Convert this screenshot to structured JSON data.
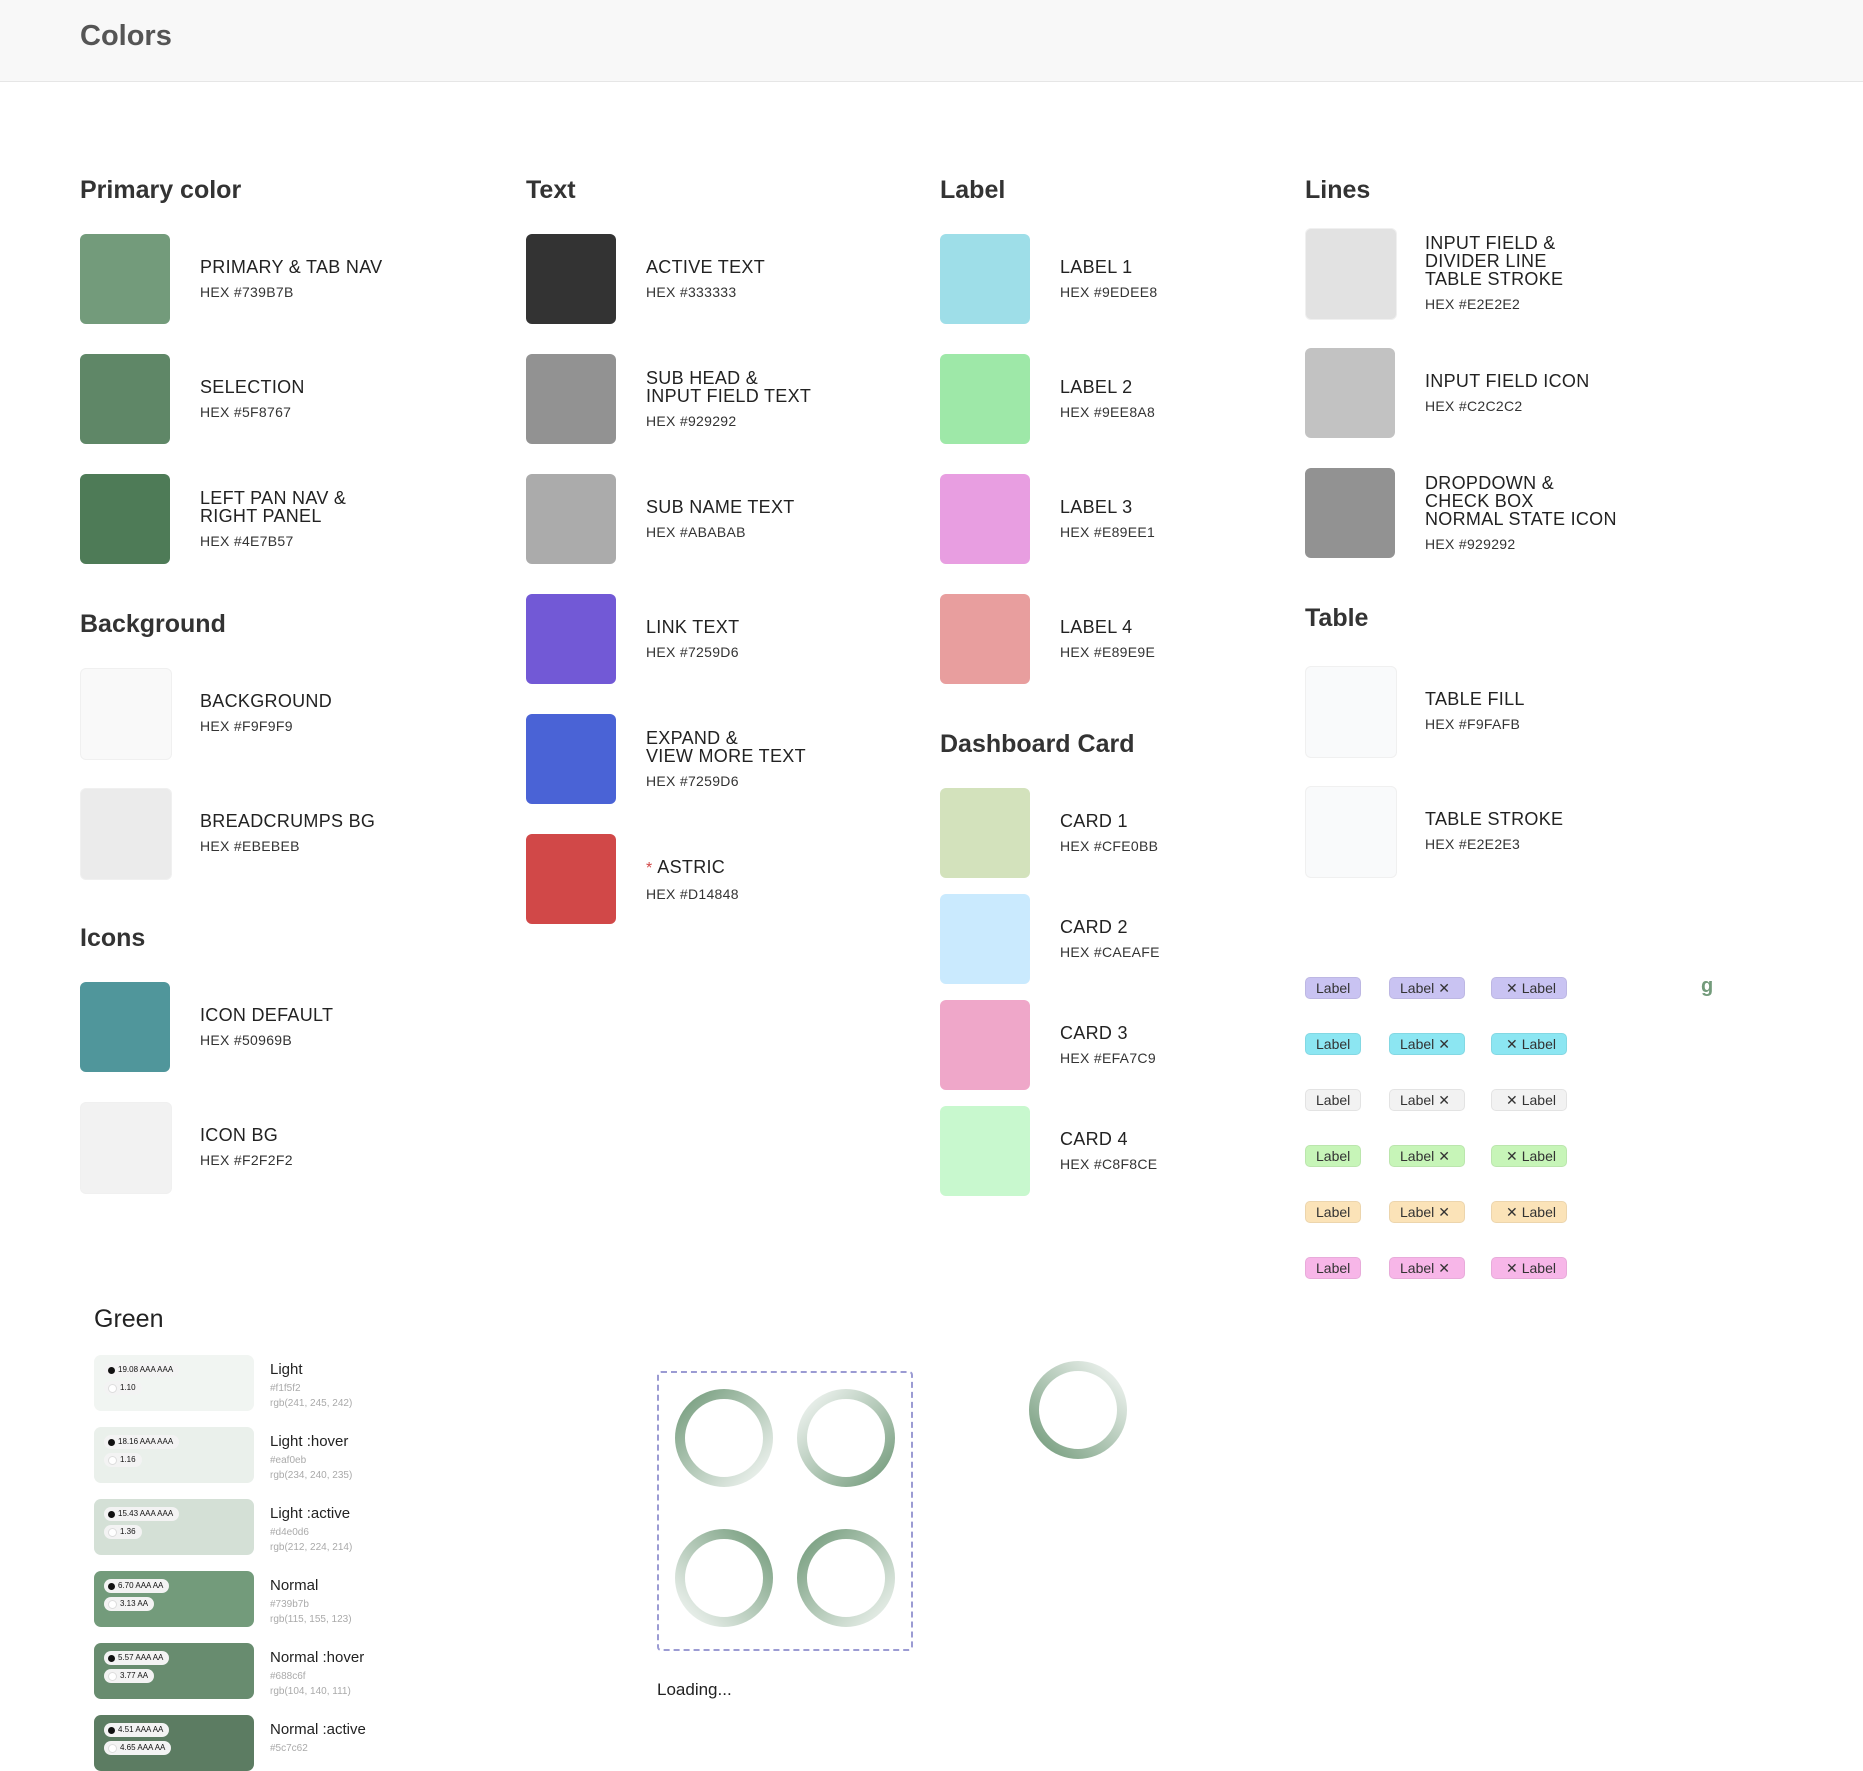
{
  "page": {
    "title": "Colors"
  },
  "sections": {
    "primary": {
      "title": "Primary color",
      "items": [
        {
          "name": "PRIMARY & TAB NAV",
          "hex": "HEX #739B7B",
          "color": "#739B7B"
        },
        {
          "name": "SELECTION",
          "hex": "HEX #5F8767",
          "color": "#5F8767"
        },
        {
          "name": "LEFT PAN NAV &\nRIGHT PANEL",
          "hex": "HEX #4E7B57",
          "color": "#4E7B57"
        }
      ]
    },
    "background": {
      "title": "Background",
      "items": [
        {
          "name": "BACKGROUND",
          "hex": "HEX #F9F9F9",
          "color": "#F9F9F9"
        },
        {
          "name": "BREADCRUMPS BG",
          "hex": "HEX #EBEBEB",
          "color": "#EBEBEB"
        }
      ]
    },
    "icons": {
      "title": "Icons",
      "items": [
        {
          "name": "ICON DEFAULT",
          "hex": "HEX #50969B",
          "color": "#50969B"
        },
        {
          "name": "ICON BG",
          "hex": "HEX #F2F2F2",
          "color": "#F2F2F2"
        }
      ]
    },
    "text": {
      "title": "Text",
      "items": [
        {
          "name": "ACTIVE TEXT",
          "hex": "HEX #333333",
          "color": "#333333"
        },
        {
          "name": "SUB HEAD &\nINPUT FIELD TEXT",
          "hex": "HEX #929292",
          "color": "#929292"
        },
        {
          "name": "SUB NAME TEXT",
          "hex": "HEX #ABABAB",
          "color": "#ABABAB"
        },
        {
          "name": "LINK TEXT",
          "hex": "HEX #7259D6",
          "color": "#7259D6"
        },
        {
          "name": "EXPAND &\nVIEW MORE TEXT",
          "hex": "HEX #7259D6",
          "color": "#4A63D6"
        },
        {
          "required_mark": "*",
          "name": "ASTRIC",
          "hex": "HEX #D14848",
          "color": "#D14848"
        }
      ]
    },
    "label": {
      "title": "Label",
      "items": [
        {
          "name": "LABEL 1",
          "hex": "HEX #9EDEE8",
          "color": "#9EDEE8"
        },
        {
          "name": "LABEL 2",
          "hex": "HEX #9EE8A8",
          "color": "#9EE8A8"
        },
        {
          "name": "LABEL 3",
          "hex": "HEX #E89EE1",
          "color": "#E89EE1"
        },
        {
          "name": "LABEL 4",
          "hex": "HEX #E89E9E",
          "color": "#E89E9E"
        }
      ]
    },
    "dashboard": {
      "title": "Dashboard Card",
      "items": [
        {
          "name": "CARD 1",
          "hex": "HEX #CFE0BB",
          "color": "#D3E2BC"
        },
        {
          "name": "CARD 2",
          "hex": "HEX #CAEAFE",
          "color": "#CAEAFE"
        },
        {
          "name": "CARD 3",
          "hex": "HEX #EFA7C9",
          "color": "#EFA7C9"
        },
        {
          "name": "CARD 4",
          "hex": "HEX #C8F8CE",
          "color": "#C8F8CE"
        }
      ]
    },
    "lines": {
      "title": "Lines",
      "items": [
        {
          "name": "INPUT FIELD &\nDIVIDER LINE\nTABLE STROKE",
          "hex": "HEX #E2E2E2",
          "color": "#E2E2E2"
        },
        {
          "name": "INPUT FIELD ICON",
          "hex": "HEX #C2C2C2",
          "color": "#C2C2C2"
        },
        {
          "name": "DROPDOWN &\nCHECK BOX\nNORMAL STATE ICON",
          "hex": "HEX #929292",
          "color": "#929292"
        }
      ]
    },
    "table": {
      "title": "Table",
      "items": [
        {
          "name": "TABLE FILL",
          "hex": "HEX #F9FAFB",
          "color": "#F9FAFB"
        },
        {
          "name": "TABLE STROKE",
          "hex": "HEX #E2E2E3",
          "color": "#F9FAFB"
        }
      ]
    }
  },
  "chips": {
    "label": "Label",
    "close_glyph": "✕",
    "rows": [
      "#c9c3f2",
      "#8ce6f2",
      "#f2f2f2",
      "#c7f5b8",
      "#fbe3b8",
      "#f7b6e8"
    ]
  },
  "stray_glyph": "g",
  "green": {
    "title": "Green",
    "items": [
      {
        "name": "Light",
        "hex": "#f1f5f2",
        "rgb": "rgb(241, 245, 242)",
        "color": "#f1f5f2",
        "badge1": "19.08 AAA AAA",
        "badge2": "1.10"
      },
      {
        "name": "Light :hover",
        "hex": "#eaf0eb",
        "rgb": "rgb(234, 240, 235)",
        "color": "#eaf0eb",
        "badge1": "18.16 AAA AAA",
        "badge2": "1.16"
      },
      {
        "name": "Light :active",
        "hex": "#d4e0d6",
        "rgb": "rgb(212, 224, 214)",
        "color": "#d4e0d6",
        "badge1": "15.43 AAA AAA",
        "badge2": "1.36"
      },
      {
        "name": "Normal",
        "hex": "#739b7b",
        "rgb": "rgb(115, 155, 123)",
        "color": "#739b7b",
        "badge1": "6.70 AAA AA",
        "badge2": "3.13 AA"
      },
      {
        "name": "Normal :hover",
        "hex": "#688c6f",
        "rgb": "rgb(104, 140, 111)",
        "color": "#688c6f",
        "badge1": "5.57 AAA AA",
        "badge2": "3.77 AA"
      },
      {
        "name": "Normal :active",
        "hex": "#5c7c62",
        "rgb": "",
        "color": "#5c7c62",
        "badge1": "4.51 AAA AA",
        "badge2": "4.65 AAA AA"
      }
    ]
  },
  "loading": {
    "text": "Loading..."
  }
}
